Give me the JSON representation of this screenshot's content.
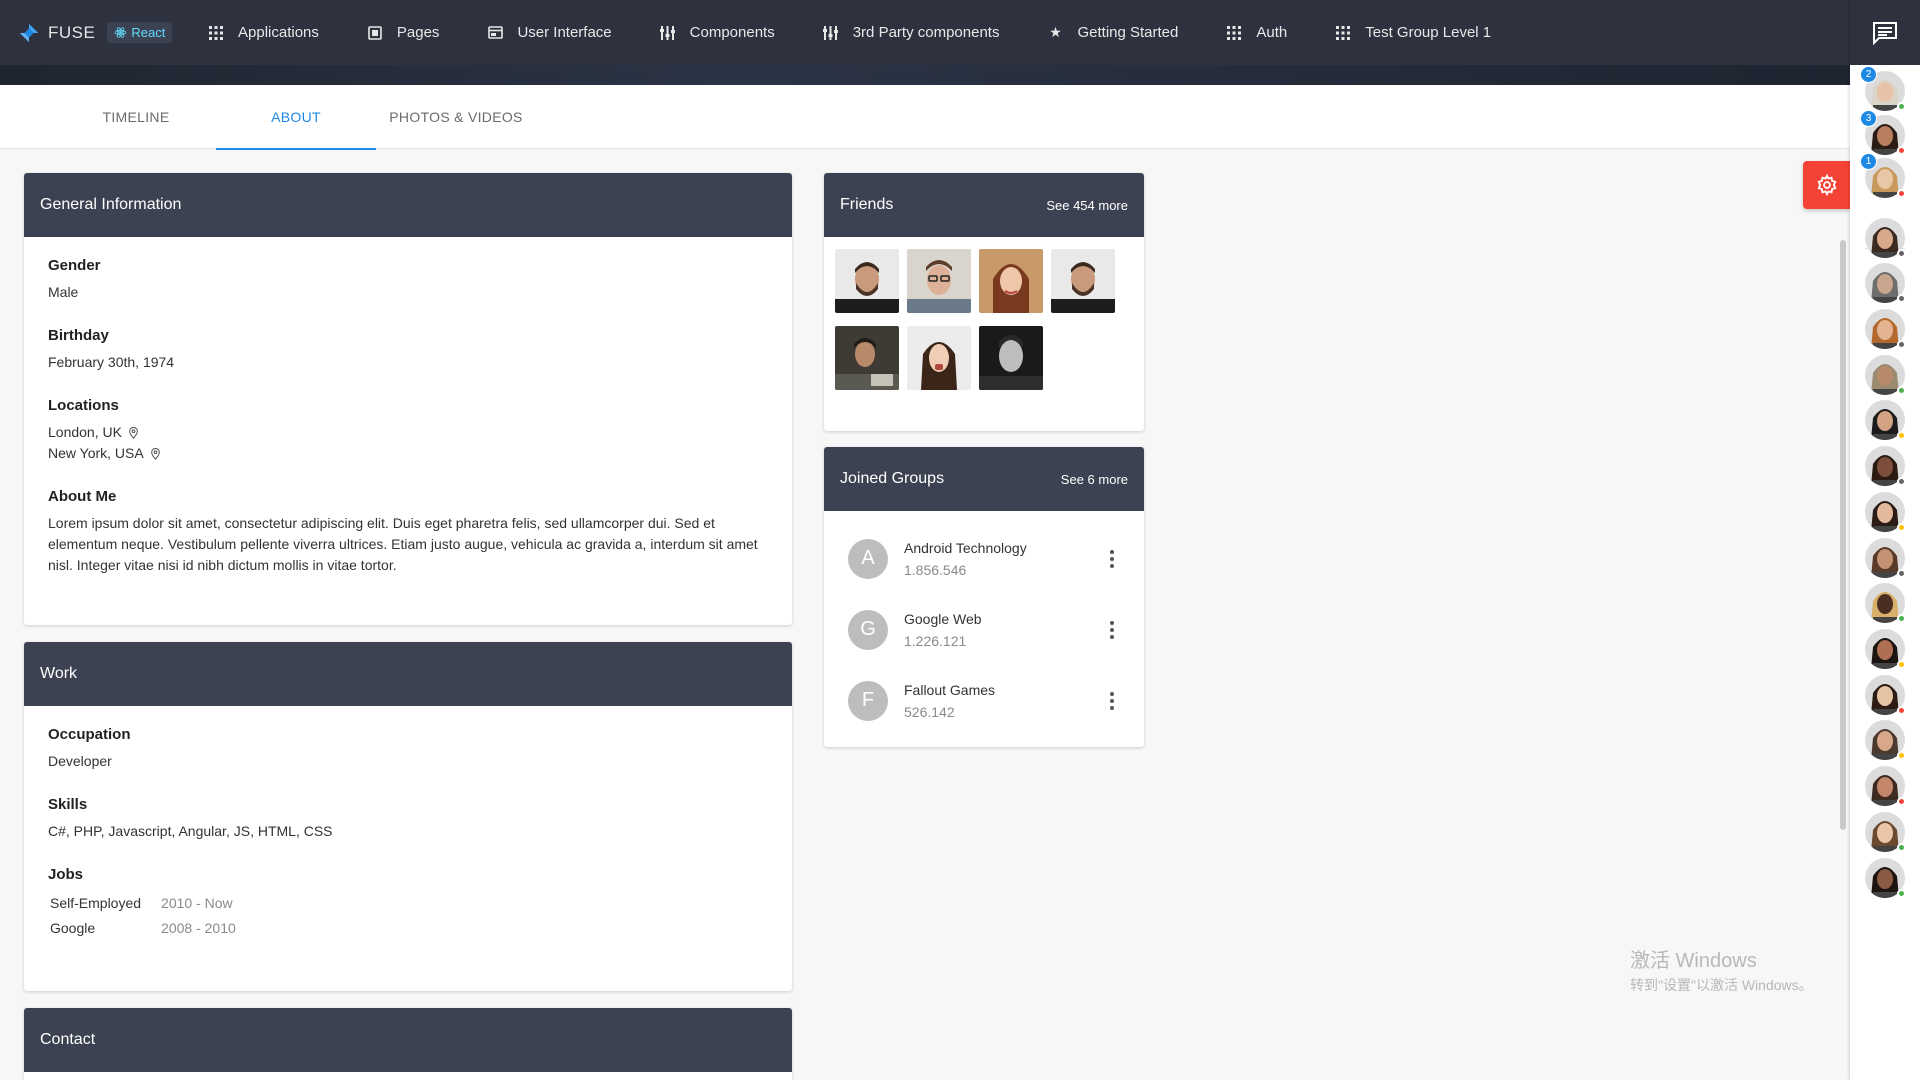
{
  "brand": {
    "name": "FUSE",
    "badge": "React"
  },
  "nav": [
    {
      "label": "Applications",
      "icon": "apps-icon"
    },
    {
      "label": "Pages",
      "icon": "pages-icon"
    },
    {
      "label": "User Interface",
      "icon": "web-icon"
    },
    {
      "label": "Components",
      "icon": "components-icon"
    },
    {
      "label": "3rd Party components",
      "icon": "components-icon"
    },
    {
      "label": "Getting Started",
      "icon": "star-icon"
    },
    {
      "label": "Auth",
      "icon": "apps-icon"
    },
    {
      "label": "Test Group Level 1",
      "icon": "apps-icon"
    }
  ],
  "tabs": [
    {
      "label": "TIMELINE",
      "active": false
    },
    {
      "label": "ABOUT",
      "active": true
    },
    {
      "label": "PHOTOS & VIDEOS",
      "active": false
    }
  ],
  "general": {
    "title": "General Information",
    "gender_label": "Gender",
    "gender": "Male",
    "birthday_label": "Birthday",
    "birthday": "February 30th, 1974",
    "locations_label": "Locations",
    "locations": [
      "London, UK",
      "New York, USA"
    ],
    "about_label": "About Me",
    "about": "Lorem ipsum dolor sit amet, consectetur adipiscing elit. Duis eget pharetra felis, sed ullamcorper dui. Sed et elementum neque. Vestibulum pellente viverra ultrices. Etiam justo augue, vehicula ac gravida a, interdum sit amet nisl. Integer vitae nisi id nibh dictum mollis in vitae tortor."
  },
  "work": {
    "title": "Work",
    "occupation_label": "Occupation",
    "occupation": "Developer",
    "skills_label": "Skills",
    "skills": "C#, PHP, Javascript, Angular, JS, HTML, CSS",
    "jobs_label": "Jobs",
    "jobs": [
      {
        "company": "Self-Employed",
        "period": "2010 - Now"
      },
      {
        "company": "Google",
        "period": "2008 - 2010"
      }
    ]
  },
  "contact": {
    "title": "Contact"
  },
  "friends": {
    "title": "Friends",
    "more": "See 454 more",
    "count_shown": 7
  },
  "groups": {
    "title": "Joined Groups",
    "more": "See 6 more",
    "items": [
      {
        "initial": "A",
        "name": "Android Technology",
        "members": "1.856.546"
      },
      {
        "initial": "G",
        "name": "Google Web",
        "members": "1.226.121"
      },
      {
        "initial": "F",
        "name": "Fallout Games",
        "members": "526.142"
      }
    ]
  },
  "chat": {
    "contacts": [
      {
        "unread": "2",
        "status": "online"
      },
      {
        "unread": "3",
        "status": "do-not-disturb"
      },
      {
        "unread": "1",
        "status": "do-not-disturb"
      },
      {
        "unread": "",
        "status": "offline"
      },
      {
        "unread": "",
        "status": "offline"
      },
      {
        "unread": "",
        "status": "offline"
      },
      {
        "unread": "",
        "status": "online"
      },
      {
        "unread": "",
        "status": "away"
      },
      {
        "unread": "",
        "status": "offline"
      },
      {
        "unread": "",
        "status": "away"
      },
      {
        "unread": "",
        "status": "offline"
      },
      {
        "unread": "",
        "status": "online"
      },
      {
        "unread": "",
        "status": "away"
      },
      {
        "unread": "",
        "status": "do-not-disturb"
      },
      {
        "unread": "",
        "status": "away"
      },
      {
        "unread": "",
        "status": "do-not-disturb"
      },
      {
        "unread": "",
        "status": "online"
      },
      {
        "unread": "",
        "status": "online"
      }
    ]
  },
  "watermark": {
    "line1": "激活 Windows",
    "line2": "转到\"设置\"以激活 Windows。"
  },
  "colors": {
    "nav_bg": "#2d323e",
    "card_head": "#3c4252",
    "accent": "#1e88e5",
    "settings": "#f44336",
    "online": "#4caf50",
    "away": "#ffc107",
    "dnd": "#f44336",
    "offline": "#646464"
  }
}
